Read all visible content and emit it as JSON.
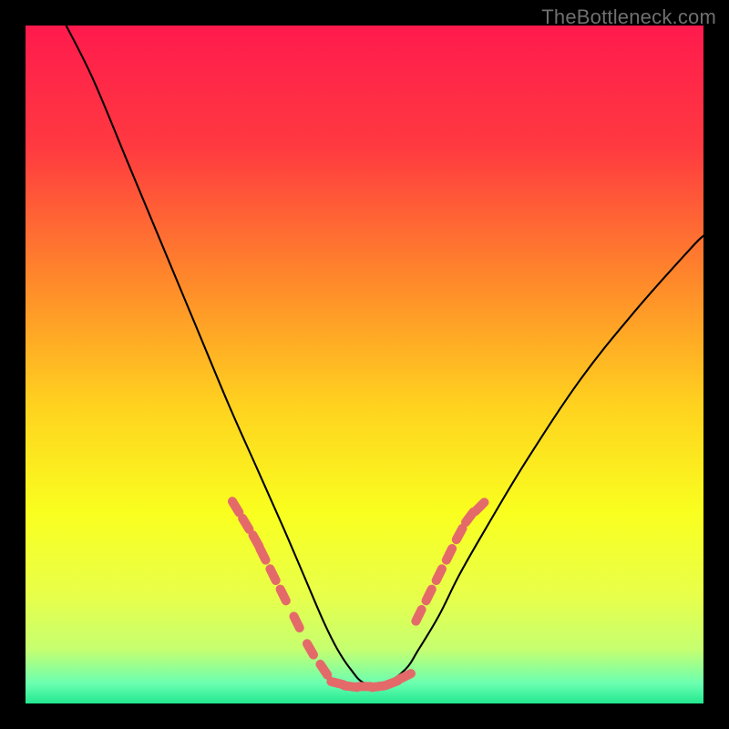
{
  "watermark": "TheBottleneck.com",
  "chart_data": {
    "type": "line",
    "title": "",
    "xlabel": "",
    "ylabel": "",
    "xlim": [
      0,
      100
    ],
    "ylim": [
      0,
      100
    ],
    "grid": false,
    "legend": false,
    "notes": "No axis ticks or numeric labels are visible; V-shaped bottleneck curve over a thermal gradient. Values below are estimated pixel-fraction positions (0–100) read off the image, not real performance numbers.",
    "series": [
      {
        "name": "main-curve",
        "color": "#000000",
        "x": [
          6,
          10,
          15,
          20,
          25,
          30,
          34,
          38,
          41,
          44,
          46,
          48,
          50,
          53,
          56,
          58,
          61,
          64,
          68,
          74,
          82,
          90,
          98,
          100
        ],
        "y": [
          100,
          92,
          80,
          68,
          56,
          44,
          35,
          26,
          19,
          12,
          8,
          5,
          3,
          3,
          5,
          8,
          13,
          19,
          26,
          36,
          48,
          58,
          67,
          69
        ]
      },
      {
        "name": "bead-markers-left",
        "color": "#e46a6a",
        "x": [
          31,
          32.5,
          34,
          35,
          36.5,
          38,
          40,
          42,
          44
        ],
        "y": [
          29,
          26.5,
          24,
          22,
          19,
          16,
          12,
          8,
          5
        ]
      },
      {
        "name": "bead-markers-bottom",
        "color": "#e46a6a",
        "x": [
          46,
          48,
          50,
          52,
          54,
          56
        ],
        "y": [
          3,
          2.5,
          2.5,
          2.5,
          3,
          4
        ]
      },
      {
        "name": "bead-markers-right",
        "color": "#e46a6a",
        "x": [
          58,
          59.5,
          61,
          62.5,
          64,
          65.5,
          67
        ],
        "y": [
          13,
          16,
          19,
          22,
          25,
          27.5,
          29
        ]
      }
    ],
    "background_gradient_stops": [
      {
        "offset": 0.0,
        "color": "#ff1a4d"
      },
      {
        "offset": 0.18,
        "color": "#ff3a40"
      },
      {
        "offset": 0.38,
        "color": "#ff8a2a"
      },
      {
        "offset": 0.56,
        "color": "#ffd21f"
      },
      {
        "offset": 0.72,
        "color": "#f9ff1f"
      },
      {
        "offset": 0.84,
        "color": "#e8ff4a"
      },
      {
        "offset": 0.92,
        "color": "#c6ff70"
      },
      {
        "offset": 0.97,
        "color": "#6bffb0"
      },
      {
        "offset": 1.0,
        "color": "#23e890"
      }
    ]
  }
}
